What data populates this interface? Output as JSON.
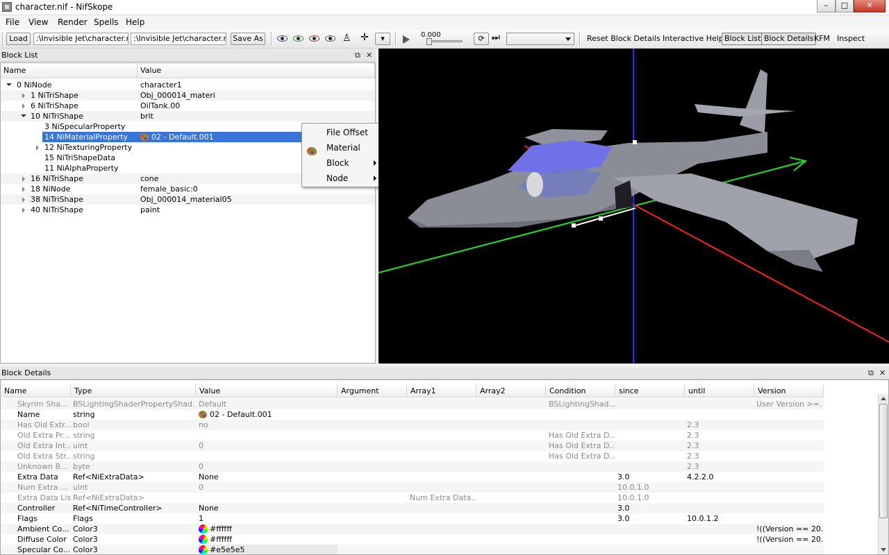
{
  "window": {
    "title": "character.nif - NifSkope",
    "minimize": "–",
    "maximize": "□",
    "close": "✕"
  },
  "menu": [
    "File",
    "View",
    "Render",
    "Spells",
    "Help"
  ],
  "toolbar": {
    "load": "Load",
    "path1": ":\\Invisible Jet\\character.nif",
    "path2": ":\\Invisible Jet\\character.nif",
    "save_as": "Save As",
    "time": "0.000",
    "reset_block_details": "Reset Block Details",
    "interactive_help": "Interactive Help",
    "block_list": "Block List",
    "block_details": "Block Details",
    "kfm": "KFM",
    "inspect": "Inspect"
  },
  "block_list": {
    "title": "Block List",
    "col_name": "Name",
    "col_value": "Value",
    "rows": [
      {
        "name": "0 NiNode",
        "value": "character1"
      },
      {
        "name": "1 NiTriShape",
        "value": "Obj_000014_materi"
      },
      {
        "name": "6 NiTriShape",
        "value": "OilTank.00"
      },
      {
        "name": "10 NiTriShape",
        "value": "brit"
      },
      {
        "name": "3 NiSpecularProperty",
        "value": ""
      },
      {
        "name": "14 NiMaterialProperty",
        "value": "02 - Default.001"
      },
      {
        "name": "12 NiTexturingProperty",
        "value": ""
      },
      {
        "name": "15 NiTriShapeData",
        "value": ""
      },
      {
        "name": "11 NiAlphaProperty",
        "value": ""
      },
      {
        "name": "16 NiTriShape",
        "value": "cone"
      },
      {
        "name": "18 NiNode",
        "value": "female_basic:0"
      },
      {
        "name": "38 NiTriShape",
        "value": "Obj_000014_material05"
      },
      {
        "name": "40 NiTriShape",
        "value": "paint"
      }
    ]
  },
  "context_menu": {
    "items": [
      "File Offset",
      "Material",
      "Block",
      "Node"
    ]
  },
  "block_details": {
    "title": "Block Details",
    "columns": [
      "Name",
      "Type",
      "Value",
      "Argument",
      "Array1",
      "Array2",
      "Condition",
      "since",
      "until",
      "Version Condition"
    ],
    "rows": [
      [
        "Skyrim Sha...",
        "BSLightingShaderPropertyShad...",
        "Default",
        "",
        "",
        "",
        "BSLightingShad...",
        "",
        "",
        "User Version >=..."
      ],
      [
        "Name",
        "string",
        "02 - Default.001",
        "",
        "",
        "",
        "",
        "",
        "",
        ""
      ],
      [
        "Has Old Extr...",
        "bool",
        "no",
        "",
        "",
        "",
        "",
        "",
        "2.3",
        ""
      ],
      [
        "Old Extra Pr...",
        "string",
        "",
        "",
        "",
        "",
        "Has Old Extra D...",
        "",
        "2.3",
        ""
      ],
      [
        "Old Extra Int...",
        "uint",
        "0",
        "",
        "",
        "",
        "Has Old Extra D...",
        "",
        "2.3",
        ""
      ],
      [
        "Old Extra Str...",
        "string",
        "",
        "",
        "",
        "",
        "Has Old Extra D...",
        "",
        "2.3",
        ""
      ],
      [
        "Unknown B...",
        "byte",
        "0",
        "",
        "",
        "",
        "",
        "",
        "2.3",
        ""
      ],
      [
        "Extra Data",
        "Ref<NiExtraData>",
        "None",
        "",
        "",
        "",
        "",
        "3.0",
        "4.2.2.0",
        ""
      ],
      [
        "Num Extra ...",
        "uint",
        "0",
        "",
        "",
        "",
        "",
        "10.0.1.0",
        "",
        ""
      ],
      [
        "Extra Data List",
        "Ref<NiExtraData>",
        "",
        "",
        "Num Extra Data...",
        "",
        "",
        "10.0.1.0",
        "",
        ""
      ],
      [
        "Controller",
        "Ref<NiTimeController>",
        "None",
        "",
        "",
        "",
        "",
        "3.0",
        "",
        ""
      ],
      [
        "Flags",
        "Flags",
        "1",
        "",
        "",
        "",
        "",
        "3.0",
        "10.0.1.2",
        ""
      ],
      [
        "Ambient Co...",
        "Color3",
        "#ffffff",
        "",
        "",
        "",
        "",
        "",
        "",
        "!((Version == 20..."
      ],
      [
        "Diffuse Color",
        "Color3",
        "#ffffff",
        "",
        "",
        "",
        "",
        "",
        "",
        "!((Version == 20..."
      ],
      [
        "Specular Co...",
        "Color3",
        "#e5e5e5",
        "",
        "",
        "",
        "",
        "",
        "",
        ""
      ]
    ]
  },
  "colors": {
    "selection": "#3875d7",
    "axis_x": "#ff2020",
    "axis_y": "#20e020",
    "axis_z": "#2030ff",
    "viewport_bg": "#000000"
  }
}
